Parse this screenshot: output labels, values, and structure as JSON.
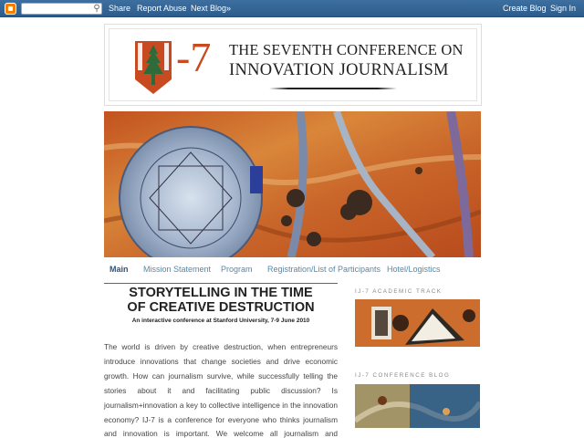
{
  "navbar": {
    "share": "Share",
    "report_abuse": "Report Abuse",
    "next_blog": "Next Blog»",
    "create_blog": "Create Blog",
    "sign_in": "Sign In"
  },
  "header": {
    "logo_text": "-7",
    "line1": "THE SEVENTH CONFERENCE ON",
    "line2": "INNOVATION JOURNALISM"
  },
  "tabs": [
    {
      "label": "Main",
      "active": true
    },
    {
      "label": "Mission Statement"
    },
    {
      "label": "Program"
    },
    {
      "label": "Registration/List of Participants"
    },
    {
      "label": "Hotel/Logistics"
    }
  ],
  "post": {
    "title_line1": "STORYTELLING IN THE TIME",
    "title_line2": "OF CREATIVE DESTRUCTION",
    "subtitle": "An interactive conference at Stanford University, 7-9 June 2010",
    "body": "The world is driven by creative destruction, when entrepreneurs introduce innovations that change societies and drive economic growth. How can journalism survive, while successfully telling the stories about it and facilitating public discussion? Is journalism+innovation a key to collective intelligence in the innovation economy? IJ-7 is a conference for everyone who thinks journalism and innovation is important. We welcome all journalism and innovation stakeholders: journalists, industry, policy-makers in media"
  },
  "sidebar": {
    "academic_heading": "IJ-7 ACADEMIC TRACK",
    "blog_heading": "IJ-7 CONFERENCE BLOG"
  },
  "colors": {
    "navbar": "#2c5c8a",
    "logo_orange": "#c74a21",
    "tab_link": "#5588aa"
  }
}
